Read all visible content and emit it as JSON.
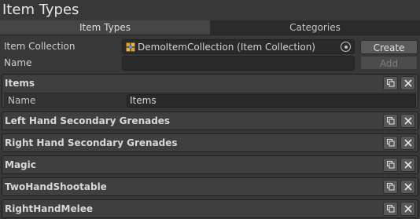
{
  "window": {
    "title": "Item Types"
  },
  "tabs": [
    {
      "label": "Item Types",
      "active": true
    },
    {
      "label": "Categories",
      "active": false
    }
  ],
  "form": {
    "collection_label": "Item Collection",
    "collection_value": "DemoItemCollection (Item Collection)",
    "collection_icon": "item-collection-icon",
    "name_label": "Name",
    "name_value": "",
    "create_label": "Create",
    "add_label": "Add"
  },
  "items": [
    {
      "title": "Items",
      "expanded": true,
      "field_label": "Name",
      "field_value": "Items"
    },
    {
      "title": "Left Hand Secondary Grenades",
      "expanded": false
    },
    {
      "title": "Right Hand Secondary Grenades",
      "expanded": false
    },
    {
      "title": "Magic",
      "expanded": false
    },
    {
      "title": "TwoHandShootable",
      "expanded": false
    },
    {
      "title": "RightHandMelee",
      "expanded": false
    }
  ],
  "colors": {
    "background": "#383838",
    "panel": "#3f3f3f",
    "field": "#2a2a2a",
    "button": "#585858"
  }
}
